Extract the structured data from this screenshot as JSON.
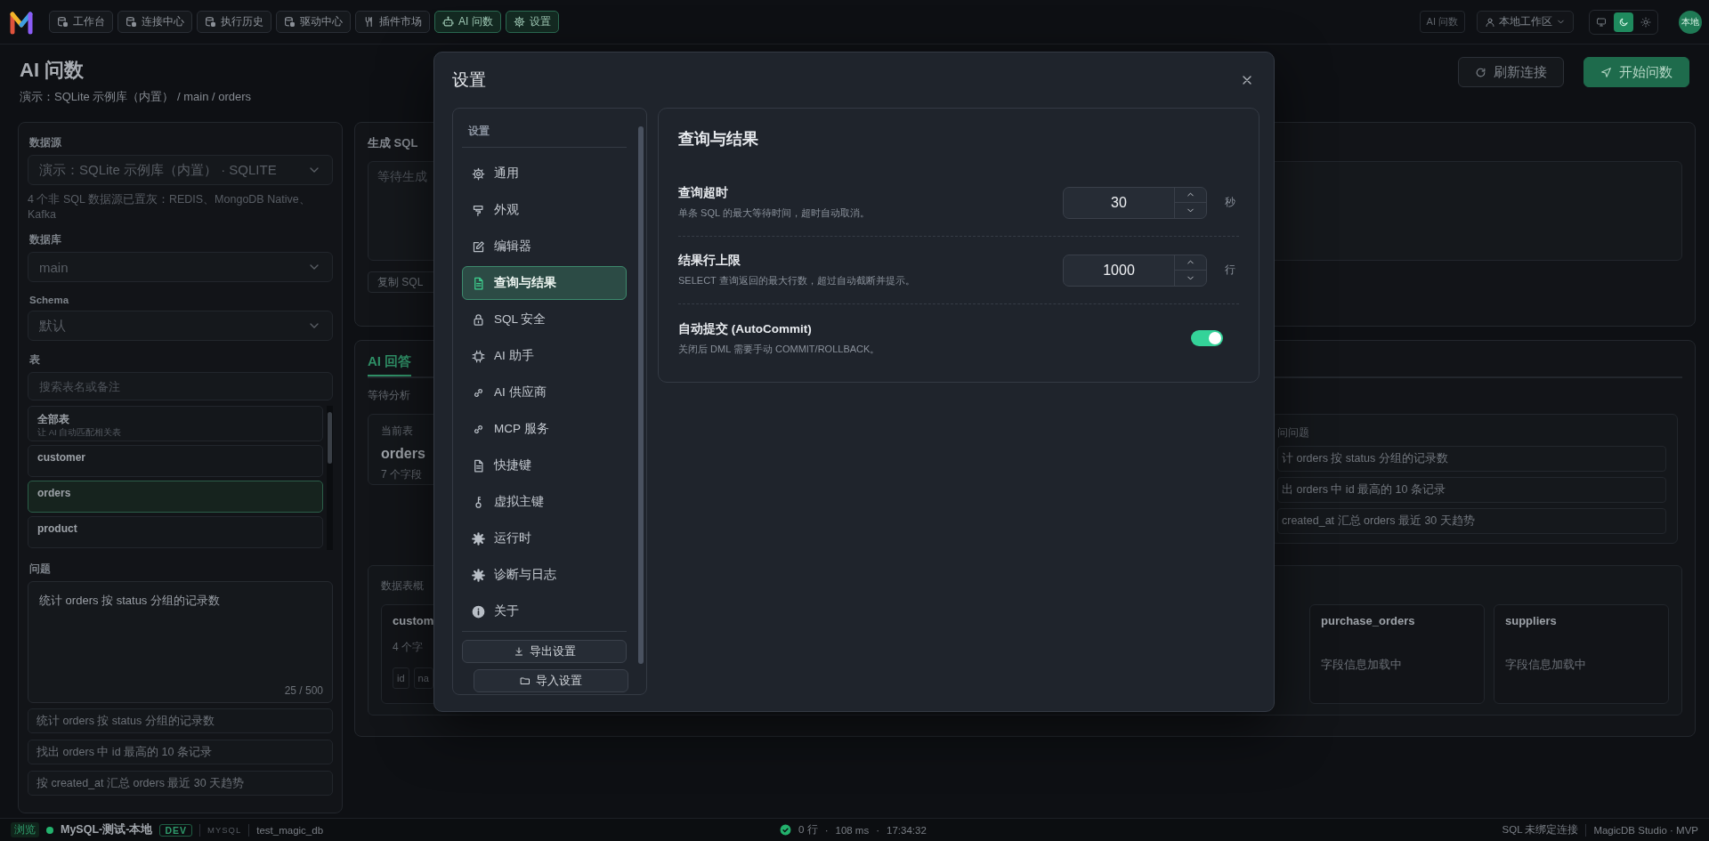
{
  "topbar": {
    "nav": [
      {
        "label": "工作台",
        "selected": false
      },
      {
        "label": "连接中心",
        "selected": false
      },
      {
        "label": "执行历史",
        "selected": false
      },
      {
        "label": "驱动中心",
        "selected": false
      },
      {
        "label": "插件市场",
        "selected": false
      },
      {
        "label": "AI 问数",
        "selected": true
      },
      {
        "label": "设置",
        "selected": true
      }
    ],
    "mode_badge": "AI 问数",
    "workspace": "本地工作区",
    "theme": [
      {
        "selected": false
      },
      {
        "selected": true
      },
      {
        "selected": false
      }
    ],
    "avatar": "本地"
  },
  "header": {
    "title": "AI 问数",
    "subtitle": "演示：SQLite 示例库（内置） / main / orders",
    "buttons": [
      "刷新连接",
      "开始问数"
    ]
  },
  "query_panel": {
    "datasource_label": "数据源",
    "datasource": "演示：SQLite 示例库（内置） · SQLITE",
    "datasource_note": "4 个非 SQL 数据源已置灰：REDIS、MongoDB Native、Kafka",
    "database_label": "数据库",
    "database": "main",
    "schema_label": "Schema",
    "schema": "默认",
    "table_label": "表",
    "table_search_placeholder": "搜索表名或备注",
    "tables": [
      {
        "name": "全部表",
        "note": "让 AI 自动匹配相关表",
        "selected": false
      },
      {
        "name": "customer",
        "selected": false
      },
      {
        "name": "orders",
        "selected": true
      },
      {
        "name": "product",
        "selected": false
      }
    ],
    "question_label": "问题",
    "question": "统计 orders 按 status 分组的记录数",
    "counter": "25 / 500",
    "suggestions": [
      "统计 orders 按 status 分组的记录数",
      "找出 orders 中 id 最高的 10 条记录",
      "按 created_at 汇总 orders 最近 30 天趋势"
    ]
  },
  "sql_card": {
    "title": "生成 SQL",
    "placeholder": "等待生成",
    "copy_button": "复制 SQL"
  },
  "answer_card": {
    "tab": "AI 回答",
    "status": "等待分析",
    "current_table": {
      "label": "当前表",
      "name": "orders",
      "fields": "7 个字段"
    },
    "questions": {
      "title": "问问题",
      "items": [
        "计 orders 按 status 分组的记录数",
        "出 orders 中 id 最高的 10 条记录",
        "created_at 汇总 orders 最近 30 天趋势"
      ]
    },
    "overview": {
      "title": "数据表概",
      "tables": [
        {
          "name": "custom",
          "fields": "4 个字",
          "columns": [
            "id",
            "na"
          ]
        },
        {
          "name": "purchase_orders",
          "note": "字段信息加载中"
        },
        {
          "name": "suppliers",
          "note": "字段信息加载中"
        }
      ]
    }
  },
  "status_bar": {
    "mode": "浏览",
    "connection": "MySQL-测试-本地",
    "env": "DEV",
    "db_type": "MYSQL",
    "database": "test_magic_db",
    "rows": "0 行",
    "separators": [
      "·",
      "·"
    ],
    "duration": "108 ms",
    "time": "17:34:32",
    "binding": "SQL 未绑定连接",
    "product": "MagicDB Studio · MVP"
  },
  "settings_dialog": {
    "title": "设置",
    "nav_title": "设置",
    "nav": [
      {
        "label": "通用",
        "selected": false
      },
      {
        "label": "外观",
        "selected": false
      },
      {
        "label": "编辑器",
        "selected": false
      },
      {
        "label": "查询与结果",
        "selected": true
      },
      {
        "label": "SQL 安全",
        "selected": false
      },
      {
        "label": "AI 助手",
        "selected": false
      },
      {
        "label": "AI 供应商",
        "selected": false
      },
      {
        "label": "MCP 服务",
        "selected": false
      },
      {
        "label": "快捷键",
        "selected": false
      },
      {
        "label": "虚拟主键",
        "selected": false
      },
      {
        "label": "运行时",
        "selected": false
      },
      {
        "label": "诊断与日志",
        "selected": false
      },
      {
        "label": "关于",
        "selected": false
      }
    ],
    "export_button": "导出设置",
    "import_button": "导入设置",
    "section_title": "查询与结果",
    "settings": [
      {
        "kind": "number",
        "label": "查询超时",
        "description": "单条 SQL 的最大等待时间，超时自动取消。",
        "value": "30",
        "unit": "秒"
      },
      {
        "kind": "number",
        "label": "结果行上限",
        "description": "SELECT 查询返回的最大行数，超过自动截断并提示。",
        "value": "1000",
        "unit": "行"
      },
      {
        "kind": "toggle",
        "label": "自动提交 (AutoCommit)",
        "description": "关闭后 DML 需要手动 COMMIT/ROLLBACK。",
        "on": true
      }
    ]
  }
}
